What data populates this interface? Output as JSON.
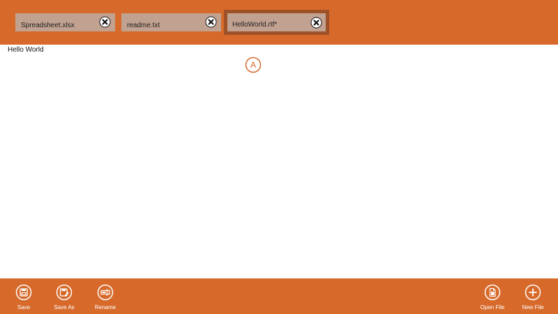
{
  "colors": {
    "accent": "#d76a2b",
    "tab_background": "#c1a190",
    "tab_selected_border": "#9e5126",
    "editor_background": "#ffffff"
  },
  "tabs": [
    {
      "label": "Spreadsheet.xlsx",
      "selected": false,
      "close_icon": "close-icon"
    },
    {
      "label": "readme.txt",
      "selected": false,
      "close_icon": "close-icon"
    },
    {
      "label": "HelloWorld.rtf*",
      "selected": true,
      "close_icon": "close-icon"
    }
  ],
  "editor": {
    "content": "Hello World",
    "marker_label": "A"
  },
  "appbar": {
    "left": [
      {
        "label": "Save",
        "icon": "save-icon"
      },
      {
        "label": "Save As",
        "icon": "save-as-icon"
      },
      {
        "label": "Rename",
        "icon": "rename-icon"
      }
    ],
    "right": [
      {
        "label": "Open File",
        "icon": "open-file-icon"
      },
      {
        "label": "New File",
        "icon": "new-file-icon"
      }
    ]
  }
}
